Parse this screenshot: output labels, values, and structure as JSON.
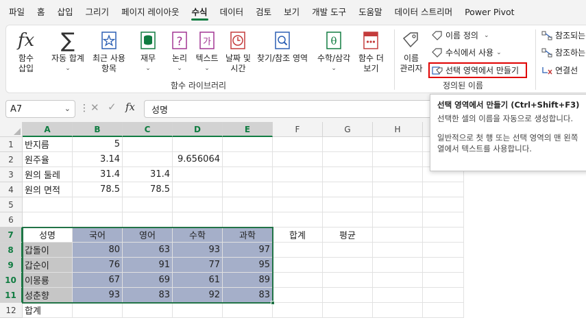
{
  "tabs": [
    "파일",
    "홈",
    "삽입",
    "그리기",
    "페이지 레이아웃",
    "수식",
    "데이터",
    "검토",
    "보기",
    "개발 도구",
    "도움말",
    "데이터 스트리머",
    "Power Pivot"
  ],
  "ribbon": {
    "insert_function": {
      "line1": "함수",
      "line2": "삽입"
    },
    "autosum": {
      "line1": "자동 합계",
      "line2": ""
    },
    "recent": {
      "line1": "최근 사용",
      "line2": "항목"
    },
    "financial": {
      "line1": "재무",
      "line2": ""
    },
    "logical": {
      "line1": "논리",
      "line2": ""
    },
    "text": {
      "line1": "텍스트",
      "line2": ""
    },
    "datetime": {
      "line1": "날짜 및",
      "line2": "시간"
    },
    "lookup": {
      "line1": "찾기/참조 영역",
      "line2": ""
    },
    "math": {
      "line1": "수학/삼각",
      "line2": ""
    },
    "more": {
      "line1": "함수 더",
      "line2": "보기"
    },
    "function_library_label": "함수 라이브러리",
    "name_manager": {
      "line1": "이름",
      "line2": "관리자"
    },
    "define_name": "이름 정의",
    "use_in_formula": "수식에서 사용",
    "create_from_selection": "선택 영역에서 만들기",
    "defined_names_label": "정의된 이름",
    "trace_precedents": "참조되는",
    "trace_dependents": "참조하는",
    "remove_arrows": "연결선"
  },
  "formula_bar": {
    "name_box": "A7",
    "formula": "성명"
  },
  "columns": [
    "A",
    "B",
    "C",
    "D",
    "E",
    "F",
    "G",
    "H"
  ],
  "rows": [
    "1",
    "2",
    "3",
    "4",
    "5",
    "6",
    "7",
    "8",
    "9",
    "10",
    "11",
    "12"
  ],
  "cells": {
    "A1": "반지름",
    "B1": "5",
    "A2": "원주율",
    "B2": "3.14",
    "D2": "9.656064",
    "A3": "원의 둘레",
    "B3": "31.4",
    "C3": "31.4",
    "A4": "원의 면적",
    "B4": "78.5",
    "C4": "78.5",
    "A7": "성명",
    "B7": "국어",
    "C7": "영어",
    "D7": "수학",
    "E7": "과학",
    "F7": "합계",
    "G7": "평균",
    "A8": "갑돌이",
    "B8": "80",
    "C8": "63",
    "D8": "93",
    "E8": "97",
    "A9": "갑순이",
    "B9": "76",
    "C9": "91",
    "D9": "77",
    "E9": "95",
    "A10": "이몽룡",
    "B10": "67",
    "C10": "69",
    "D10": "61",
    "E10": "89",
    "A11": "성춘향",
    "B11": "93",
    "C11": "83",
    "D11": "92",
    "E11": "83",
    "A12": "합계"
  },
  "tooltip": {
    "title": "선택 영역에서 만들기 (Ctrl+Shift+F3)",
    "p1": "선택한 셀의 이름을 자동으로 생성합니다.",
    "p2": "일반적으로 첫 행 또는 선택 영역의 맨 왼쪽 열에서 텍스트를 사용합니다."
  },
  "colors": {
    "accent": "#107c41",
    "highlight": "#e00000",
    "header_fill": "#c6c6c6",
    "data_fill": "#a5afc9"
  }
}
